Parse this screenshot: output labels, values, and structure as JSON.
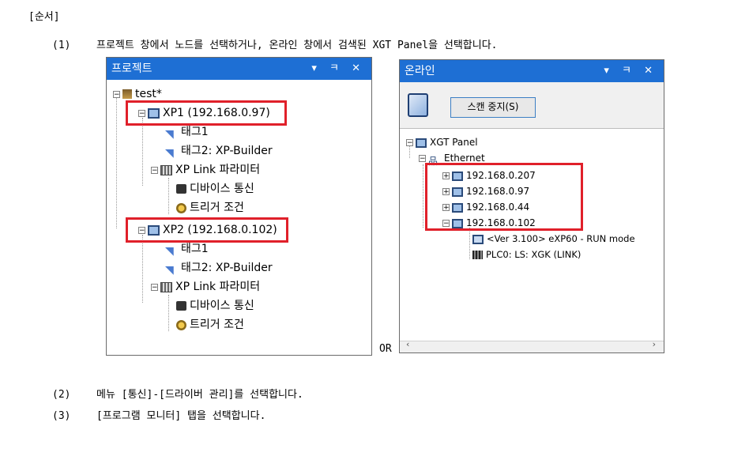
{
  "heading": "[순서]",
  "steps": [
    {
      "num": "(1)",
      "text": "프로젝트 창에서 노드를 선택하거나, 온라인 창에서 검색된 XGT Panel을 선택합니다."
    },
    {
      "num": "(2)",
      "text": "메뉴 [통신]-[드라이버 관리]를 선택합니다."
    },
    {
      "num": "(3)",
      "text": "[프로그램 모니터] 탭을 선택합니다."
    }
  ],
  "or_label": "OR",
  "project_panel": {
    "title": "프로젝트",
    "title_icons": [
      "▾",
      "ㅋ",
      "✕"
    ],
    "tree": {
      "root": "test*",
      "nodes": [
        {
          "label": "XP1 (192.168.0.97)",
          "children": [
            "태그1",
            "태그2: XP-Builder"
          ],
          "link_group": {
            "label": "XP Link 파라미터",
            "children": [
              "디바이스 통신",
              "트리거 조건"
            ]
          }
        },
        {
          "label": "XP2 (192.168.0.102)",
          "children": [
            "태그1",
            "태그2: XP-Builder"
          ],
          "link_group": {
            "label": "XP Link 파라미터",
            "children": [
              "디바이스 통신",
              "트리거 조건"
            ]
          }
        }
      ]
    }
  },
  "online_panel": {
    "title": "온라인",
    "title_icons": [
      "▾",
      "ㅋ",
      "✕"
    ],
    "scan_stop_button": "스캔 중지(S)",
    "tree": {
      "root": "XGT Panel",
      "network": "Ethernet",
      "devices": [
        "192.168.0.207",
        "192.168.0.97",
        "192.168.0.44",
        "192.168.0.102"
      ],
      "expanded_children": [
        "<Ver 3.100>  eXP60 - RUN mode",
        "PLC0: LS: XGK (LINK)"
      ]
    }
  },
  "colors": {
    "titlebar": "#1e6fd4",
    "highlight_box": "#e0202a"
  }
}
